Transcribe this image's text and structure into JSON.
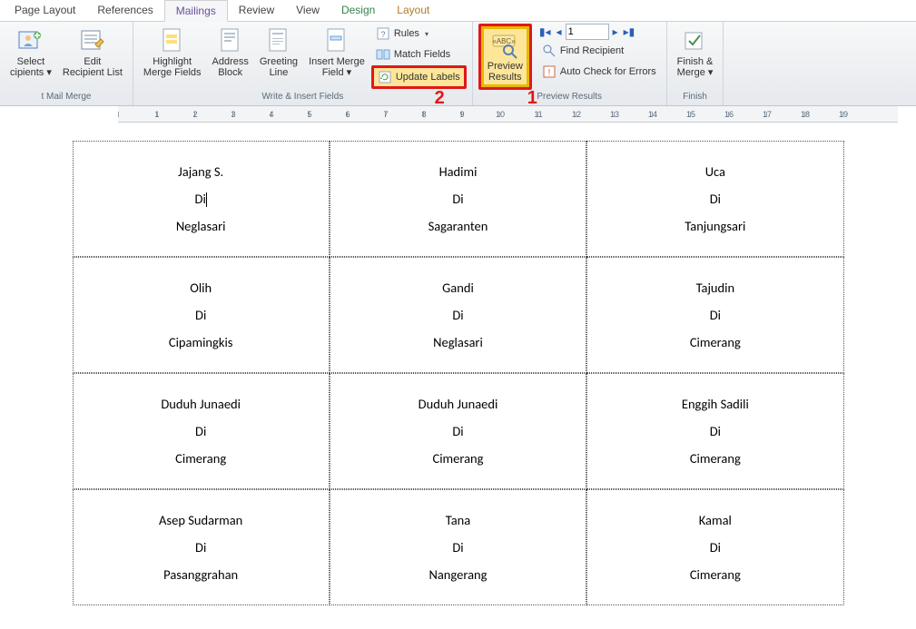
{
  "tabs": {
    "page_layout": "Page Layout",
    "references": "References",
    "mailings": "Mailings",
    "review": "Review",
    "view": "View",
    "design": "Design",
    "layout": "Layout"
  },
  "groups": {
    "start_mail_merge": "t Mail Merge",
    "write_insert": "Write & Insert Fields",
    "preview_results": "Preview Results",
    "finish": "Finish"
  },
  "buttons": {
    "select_recipients": "Select\ncipients ▾",
    "edit_recipient_list": "Edit\nRecipient List",
    "highlight_merge_fields": "Highlight\nMerge Fields",
    "address_block": "Address\nBlock",
    "greeting_line": "Greeting\nLine",
    "insert_merge_field": "Insert Merge\nField ▾",
    "rules": "Rules",
    "match_fields": "Match Fields",
    "update_labels": "Update Labels",
    "preview_results_btn": "Preview\nResults",
    "find_recipient": "Find Recipient",
    "auto_check": "Auto Check for Errors",
    "finish_merge": "Finish &\nMerge ▾"
  },
  "record_nav": {
    "value": "1"
  },
  "annotations": {
    "a1": "1",
    "a2": "2"
  },
  "labels": [
    [
      {
        "name": "Jajang S.",
        "di": "Di",
        "loc": "Neglasari",
        "cursor": true
      },
      {
        "name": "Hadimi",
        "di": "Di",
        "loc": "Sagaranten"
      },
      {
        "name": "Uca",
        "di": "Di",
        "loc": "Tanjungsari"
      }
    ],
    [
      {
        "name": "Olih",
        "di": "Di",
        "loc": "Cipamingkis"
      },
      {
        "name": "Gandi",
        "di": "Di",
        "loc": "Neglasari"
      },
      {
        "name": "Tajudin",
        "di": "Di",
        "loc": "Cimerang"
      }
    ],
    [
      {
        "name": "Duduh Junaedi",
        "di": "Di",
        "loc": "Cimerang"
      },
      {
        "name": "Duduh Junaedi",
        "di": "Di",
        "loc": "Cimerang"
      },
      {
        "name": "Enggih Sadili",
        "di": "Di",
        "loc": "Cimerang"
      }
    ],
    [
      {
        "name": "Asep Sudarman",
        "di": "Di",
        "loc": "Pasanggrahan"
      },
      {
        "name": "Tana",
        "di": "Di",
        "loc": "Nangerang"
      },
      {
        "name": "Kamal",
        "di": "Di",
        "loc": "Cimerang"
      }
    ]
  ],
  "ruler_ticks": [
    "",
    "1",
    "2",
    "3",
    "4",
    "5",
    "6",
    "7",
    "8",
    "9",
    "10",
    "11",
    "12",
    "13",
    "14",
    "15",
    "16",
    "17",
    "18",
    "19"
  ]
}
